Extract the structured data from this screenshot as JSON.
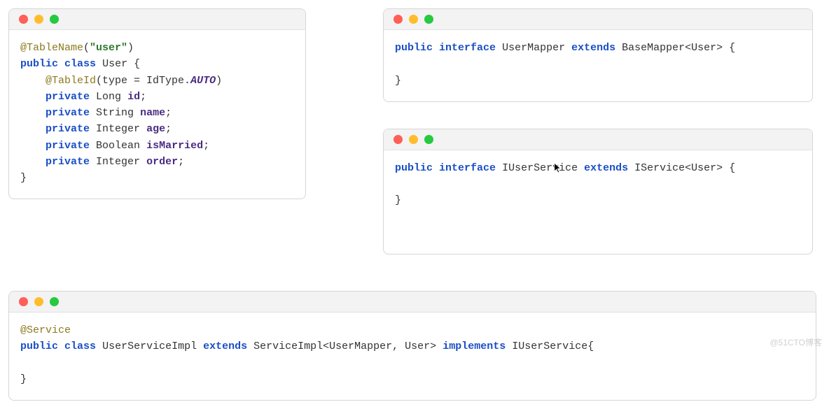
{
  "colors": {
    "red": "#ff5f56",
    "yellow": "#ffbd2e",
    "green": "#27c93f"
  },
  "watermark": "@51CTO博客",
  "cursor_in_window": 2,
  "windows": {
    "w0": {
      "tokens": [
        {
          "cls": "ann",
          "t": "@TableName"
        },
        {
          "cls": "punc",
          "t": "("
        },
        {
          "cls": "str",
          "t": "\"user\""
        },
        {
          "cls": "punc",
          "t": ")"
        },
        {
          "nl": true
        },
        {
          "cls": "kw",
          "t": "public"
        },
        {
          "sp": 1
        },
        {
          "cls": "kw",
          "t": "class"
        },
        {
          "sp": 1
        },
        {
          "cls": "type",
          "t": "User"
        },
        {
          "sp": 1
        },
        {
          "cls": "punc",
          "t": "{"
        },
        {
          "nl": true
        },
        {
          "indent": 4
        },
        {
          "cls": "ann",
          "t": "@TableId"
        },
        {
          "cls": "punc",
          "t": "(type = IdType."
        },
        {
          "cls": "enumv",
          "t": "AUTO"
        },
        {
          "cls": "punc",
          "t": ")"
        },
        {
          "nl": true
        },
        {
          "indent": 4
        },
        {
          "cls": "kw",
          "t": "private"
        },
        {
          "sp": 1
        },
        {
          "cls": "type",
          "t": "Long"
        },
        {
          "sp": 1
        },
        {
          "cls": "field",
          "t": "id"
        },
        {
          "cls": "punc",
          "t": ";"
        },
        {
          "nl": true
        },
        {
          "indent": 4
        },
        {
          "cls": "kw",
          "t": "private"
        },
        {
          "sp": 1
        },
        {
          "cls": "type",
          "t": "String"
        },
        {
          "sp": 1
        },
        {
          "cls": "field",
          "t": "name"
        },
        {
          "cls": "punc",
          "t": ";"
        },
        {
          "nl": true
        },
        {
          "indent": 4
        },
        {
          "cls": "kw",
          "t": "private"
        },
        {
          "sp": 1
        },
        {
          "cls": "type",
          "t": "Integer"
        },
        {
          "sp": 1
        },
        {
          "cls": "field",
          "t": "age"
        },
        {
          "cls": "punc",
          "t": ";"
        },
        {
          "nl": true
        },
        {
          "indent": 4
        },
        {
          "cls": "kw",
          "t": "private"
        },
        {
          "sp": 1
        },
        {
          "cls": "type",
          "t": "Boolean"
        },
        {
          "sp": 1
        },
        {
          "cls": "field",
          "t": "isMarried"
        },
        {
          "cls": "punc",
          "t": ";"
        },
        {
          "nl": true
        },
        {
          "indent": 4
        },
        {
          "cls": "kw",
          "t": "private"
        },
        {
          "sp": 1
        },
        {
          "cls": "type",
          "t": "Integer"
        },
        {
          "sp": 1
        },
        {
          "cls": "field",
          "t": "order"
        },
        {
          "cls": "punc",
          "t": ";"
        },
        {
          "nl": true
        },
        {
          "cls": "punc",
          "t": "}"
        }
      ]
    },
    "w1": {
      "tokens": [
        {
          "cls": "kw",
          "t": "public"
        },
        {
          "sp": 1
        },
        {
          "cls": "kw",
          "t": "interface"
        },
        {
          "sp": 1
        },
        {
          "cls": "type",
          "t": "UserMapper"
        },
        {
          "sp": 1
        },
        {
          "cls": "kw",
          "t": "extends"
        },
        {
          "sp": 1
        },
        {
          "cls": "type",
          "t": "BaseMapper<User>"
        },
        {
          "sp": 1
        },
        {
          "cls": "punc",
          "t": "{"
        },
        {
          "nl": true
        },
        {
          "nl": true
        },
        {
          "cls": "punc",
          "t": "}"
        }
      ]
    },
    "w2": {
      "tokens": [
        {
          "cls": "kw",
          "t": "public"
        },
        {
          "sp": 1
        },
        {
          "cls": "kw",
          "t": "interface"
        },
        {
          "sp": 1
        },
        {
          "cls": "type",
          "t": "IUserService"
        },
        {
          "sp": 1
        },
        {
          "cls": "kw",
          "t": "extends"
        },
        {
          "sp": 1
        },
        {
          "cls": "type",
          "t": "IService<User>"
        },
        {
          "sp": 1
        },
        {
          "cls": "punc",
          "t": "{"
        },
        {
          "nl": true
        },
        {
          "nl": true
        },
        {
          "cls": "punc",
          "t": "}"
        }
      ]
    },
    "w3": {
      "tokens": [
        {
          "cls": "ann",
          "t": "@Service"
        },
        {
          "nl": true
        },
        {
          "cls": "kw",
          "t": "public"
        },
        {
          "sp": 1
        },
        {
          "cls": "kw",
          "t": "class"
        },
        {
          "sp": 1
        },
        {
          "cls": "type",
          "t": "UserServiceImpl"
        },
        {
          "sp": 1
        },
        {
          "cls": "kw",
          "t": "extends"
        },
        {
          "sp": 1
        },
        {
          "cls": "type",
          "t": "ServiceImpl<UserMapper, User>"
        },
        {
          "sp": 1
        },
        {
          "cls": "kw",
          "t": "implements"
        },
        {
          "sp": 1
        },
        {
          "cls": "type",
          "t": "IUserService"
        },
        {
          "cls": "punc",
          "t": "{"
        },
        {
          "nl": true
        },
        {
          "nl": true
        },
        {
          "cls": "punc",
          "t": "}"
        }
      ]
    }
  }
}
